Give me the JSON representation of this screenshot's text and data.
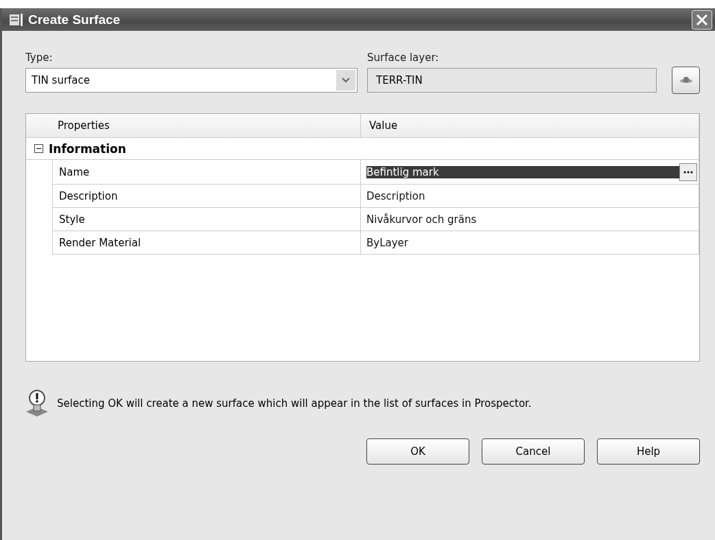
{
  "window": {
    "title": "Create Surface"
  },
  "type": {
    "label": "Type:",
    "value": "TIN surface"
  },
  "surface_layer": {
    "label": "Surface layer:",
    "value": "TERR-TIN"
  },
  "grid": {
    "columns": [
      "Properties",
      "Value"
    ],
    "group": {
      "label": "Information",
      "expanded": true,
      "rows": [
        {
          "name": "Name",
          "value": "Befintlig mark",
          "selected": true
        },
        {
          "name": "Description",
          "value": "Description",
          "selected": false
        },
        {
          "name": "Style",
          "value": "Nivåkurvor och gräns",
          "selected": false
        },
        {
          "name": "Render Material",
          "value": "ByLayer",
          "selected": false
        }
      ]
    }
  },
  "info": "Selecting OK will create a new surface which will appear in the list of surfaces in Prospector.",
  "buttons": [
    "OK",
    "Cancel",
    "Help"
  ]
}
